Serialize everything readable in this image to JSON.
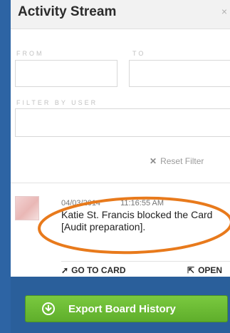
{
  "header": {
    "title": "Activity Stream",
    "close_glyph": "×"
  },
  "filters": {
    "from_label": "FROM",
    "to_label": "TO",
    "user_label": "FILTER BY USER",
    "reset_label": "Reset Filter"
  },
  "activity": {
    "date": "04/03/2014",
    "time": "11:16:55 AM",
    "text": "Katie St. Francis blocked the Card [Audit preparation].",
    "goto_label": "GO TO CARD",
    "open_label": "OPEN"
  },
  "footer": {
    "export_label": "Export Board History"
  },
  "colors": {
    "highlight": "#e87a1c",
    "button": "#6cbb35",
    "background": "#2a5f9b"
  }
}
